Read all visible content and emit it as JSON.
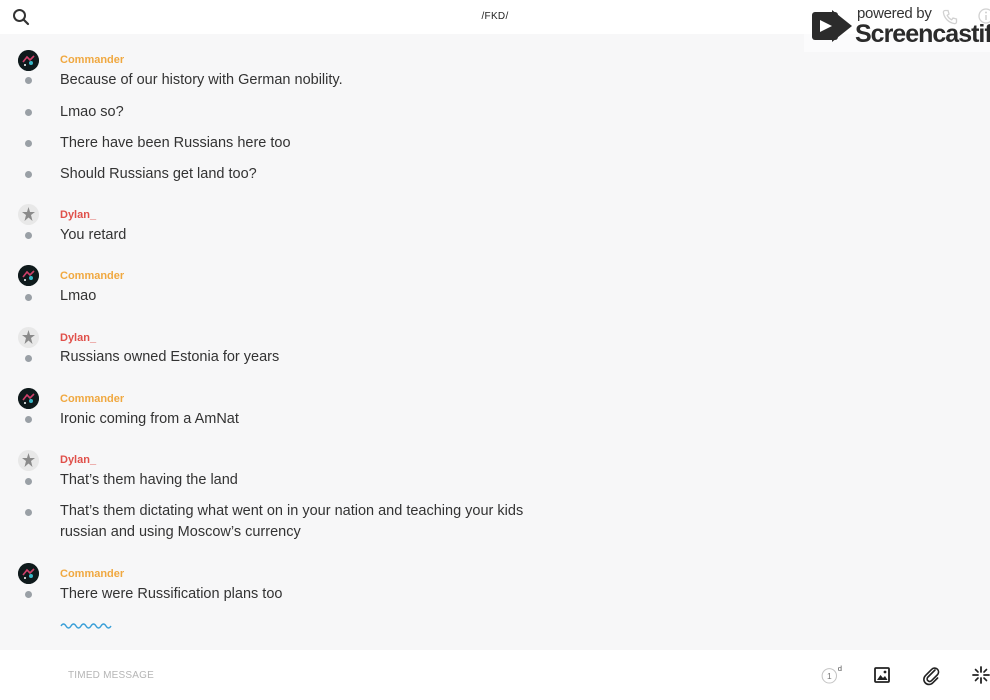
{
  "header": {
    "title": "/FKD/"
  },
  "watermark": {
    "powered_by": "powered by",
    "brand": "Screencastify"
  },
  "messages": [
    {
      "author": "Commander",
      "author_color": "#f0a840",
      "lines": [
        "Because of our history with German nobility.",
        "Lmao so?",
        "There have been Russians here too",
        "Should Russians get land too?"
      ]
    },
    {
      "author": "Dylan_",
      "author_color": "#e0504a",
      "lines": [
        "You retard"
      ]
    },
    {
      "author": "Commander",
      "author_color": "#f0a840",
      "lines": [
        "Lmao"
      ]
    },
    {
      "author": "Dylan_",
      "author_color": "#e0504a",
      "lines": [
        "Russians owned Estonia for years"
      ]
    },
    {
      "author": "Commander",
      "author_color": "#f0a840",
      "lines": [
        "Ironic coming from a AmNat"
      ]
    },
    {
      "author": "Dylan_",
      "author_color": "#e0504a",
      "lines": [
        "That’s them having the land",
        "That’s them dictating what went on in your nation and teaching your kids russian and using Moscow’s currency"
      ]
    },
    {
      "author": "Commander",
      "author_color": "#f0a840",
      "lines": [
        "There were Russification plans too"
      ]
    }
  ],
  "composer": {
    "timed_message_placeholder": "TIMED MESSAGE",
    "timer_value": "1",
    "timer_unit": "d"
  },
  "icons": [
    "search-icon",
    "phone-icon",
    "info-icon",
    "timer-icon",
    "image-icon",
    "attach-icon",
    "sparkle-icon"
  ],
  "colors": {
    "commander": "#f0a840",
    "dylan": "#e0504a",
    "typing_indicator": "#3aa0d8"
  }
}
